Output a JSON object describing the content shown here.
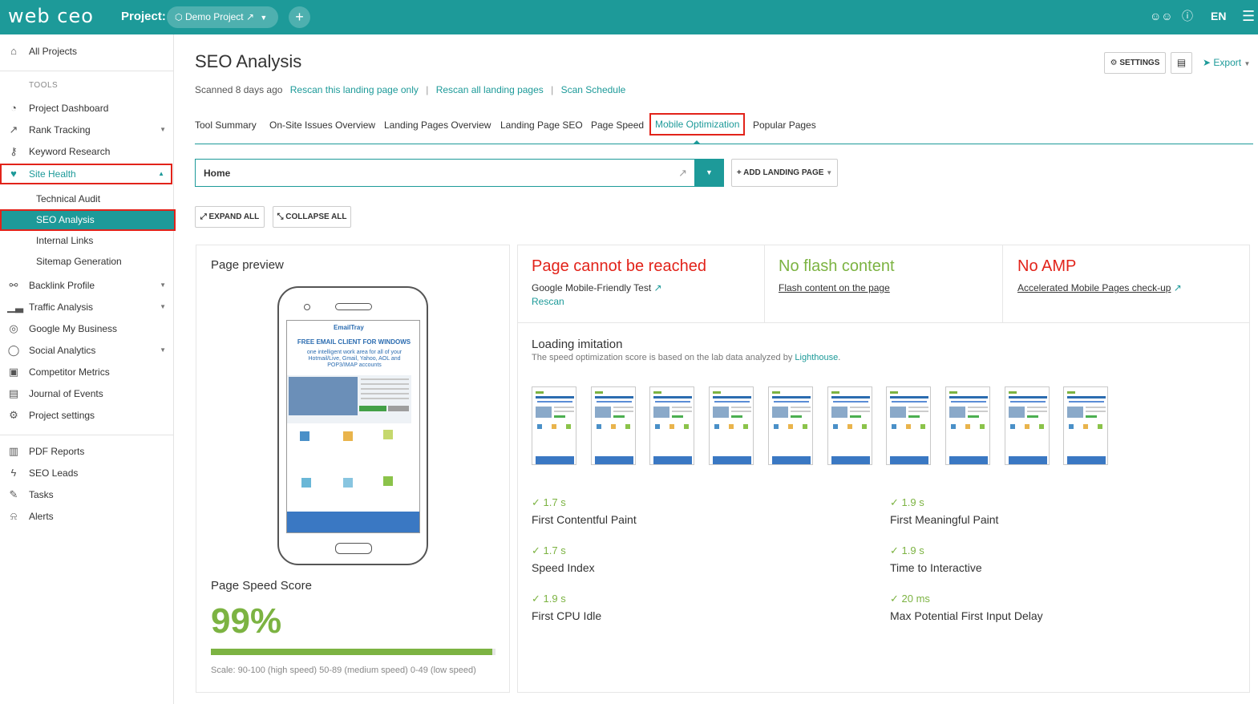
{
  "app": {
    "logo": "web ceo",
    "project_label": "Project:",
    "project_name": "Demo Project",
    "add": "+"
  },
  "topbar": {
    "lang": "EN"
  },
  "sidebar": {
    "all_projects": "All Projects",
    "tools_heading": "TOOLS",
    "items": [
      {
        "label": "Project Dashboard"
      },
      {
        "label": "Rank Tracking"
      },
      {
        "label": "Keyword Research"
      },
      {
        "label": "Site Health"
      },
      {
        "label": "Backlink Profile"
      },
      {
        "label": "Traffic Analysis"
      },
      {
        "label": "Google My Business"
      },
      {
        "label": "Social Analytics"
      },
      {
        "label": "Competitor Metrics"
      },
      {
        "label": "Journal of Events"
      },
      {
        "label": "Project settings"
      }
    ],
    "subitems": [
      {
        "label": "Technical Audit"
      },
      {
        "label": "SEO Analysis"
      },
      {
        "label": "Internal Links"
      },
      {
        "label": "Sitemap Generation"
      }
    ],
    "bottom_items": [
      {
        "label": "PDF Reports"
      },
      {
        "label": "SEO Leads"
      },
      {
        "label": "Tasks"
      },
      {
        "label": "Alerts"
      }
    ]
  },
  "header": {
    "title": "SEO Analysis",
    "scanned": "Scanned 8 days ago",
    "rescan_page": "Rescan this landing page only",
    "rescan_all": "Rescan all landing pages",
    "scan_schedule": "Scan Schedule",
    "settings": "SETTINGS",
    "export": "Export"
  },
  "tabs": [
    "Tool Summary",
    "On-Site Issues Overview",
    "Landing Pages Overview",
    "Landing Page SEO",
    "Page Speed",
    "Mobile Optimization",
    "Popular Pages"
  ],
  "landing_page": {
    "value": "Home",
    "add_button": "ADD LANDING PAGE"
  },
  "controls": {
    "expand_all": "EXPAND ALL",
    "collapse_all": "COLLAPSE ALL"
  },
  "preview": {
    "title": "Page preview",
    "screen_brand": "EmailTray",
    "screen_headline": "FREE EMAIL CLIENT FOR WINDOWS",
    "screen_sub": "one intelligent work area for all of your Hotmail/Live, Gmail, Yahoo, AOL and POP3/IMAP accounts",
    "speed_title": "Page Speed Score",
    "speed_score": "99%",
    "speed_fraction": 0.99,
    "scale_note": "Scale: 90-100 (high speed) 50-89 (medium speed) 0-49 (low speed)"
  },
  "checks": [
    {
      "title": "Page cannot be reached",
      "line1": "Google Mobile-Friendly Test",
      "line2": "Rescan"
    },
    {
      "title": "No flash content",
      "line1": "Flash content on the page"
    },
    {
      "title": "No AMP",
      "line1": "Accelerated Mobile Pages check-up"
    }
  ],
  "loading": {
    "title": "Loading imitation",
    "desc": "The speed optimization score is based on the lab data analyzed by",
    "link": "Lighthouse",
    "dot": "."
  },
  "metrics": [
    {
      "value": "1.7 s",
      "label": "First Contentful Paint"
    },
    {
      "value": "1.9 s",
      "label": "First Meaningful Paint"
    },
    {
      "value": "1.7 s",
      "label": "Speed Index"
    },
    {
      "value": "1.9 s",
      "label": "Time to Interactive"
    },
    {
      "value": "1.9 s",
      "label": "First CPU Idle"
    },
    {
      "value": "20 ms",
      "label": "Max Potential First Input Delay"
    }
  ],
  "colors": {
    "brand": "#1d9a99",
    "good": "#7cb342",
    "bad": "#e2231a",
    "highlight": "#e2231a"
  },
  "icons": [
    "home-icon",
    "dashboard-icon",
    "chart-icon",
    "key-icon",
    "heart-icon",
    "link-icon",
    "bars-icon",
    "pin-icon",
    "chat-icon",
    "binoculars-icon",
    "calendar-icon",
    "gear-icon",
    "pdf-icon",
    "bolt-icon",
    "tasks-icon",
    "bell-icon",
    "users-icon",
    "help-icon",
    "menu-icon"
  ]
}
